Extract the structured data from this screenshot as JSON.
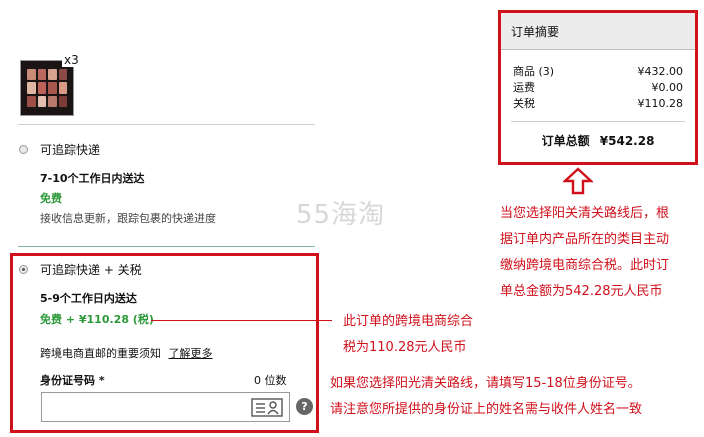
{
  "product": {
    "quantity_badge": "x3"
  },
  "shipping_options": [
    {
      "name": "可追踪快递",
      "delivery": "7-10个工作日内送达",
      "price": "免费",
      "desc": "接收信息更新，跟踪包裹的快递进度",
      "selected": false
    },
    {
      "name": "可追踪快递 + 关税",
      "delivery": "5-9个工作日内送达",
      "price": "免费 + ¥110.28 (税)",
      "selected": true
    }
  ],
  "crossborder": {
    "notice_text": "跨境电商直邮的重要须知",
    "learn_more": "了解更多"
  },
  "id_field": {
    "label": "身份证号码 *",
    "counter": "0 位数",
    "value": "",
    "help_icon_glyph": "?"
  },
  "order_summary": {
    "title": "订单摘要",
    "lines": [
      {
        "label": "商品 (3)",
        "value": "¥432.00"
      },
      {
        "label": "运费",
        "value": "¥0.00"
      },
      {
        "label": "关税",
        "value": "¥110.28"
      }
    ],
    "total_label": "订单总额",
    "total_value": "¥542.28"
  },
  "watermark": "55海淘",
  "annotations": {
    "right_note": [
      "当您选择阳关清关路线后，根",
      "据订单内产品所在的类目主动",
      "缴纳跨境电商综合税。此时订",
      "单总金额为542.28元人民币"
    ],
    "tax_note": [
      "此订单的跨境电商综合",
      "税为110.28元人民币"
    ],
    "id_note": [
      "如果您选择阳光清关路线，请填写15-18位身份证号。",
      "请注意您所提供的身份证上的姓名需与收件人姓名一致"
    ]
  },
  "colors": {
    "accent_red": "#d0101b",
    "price_green": "#2f9a3b"
  }
}
